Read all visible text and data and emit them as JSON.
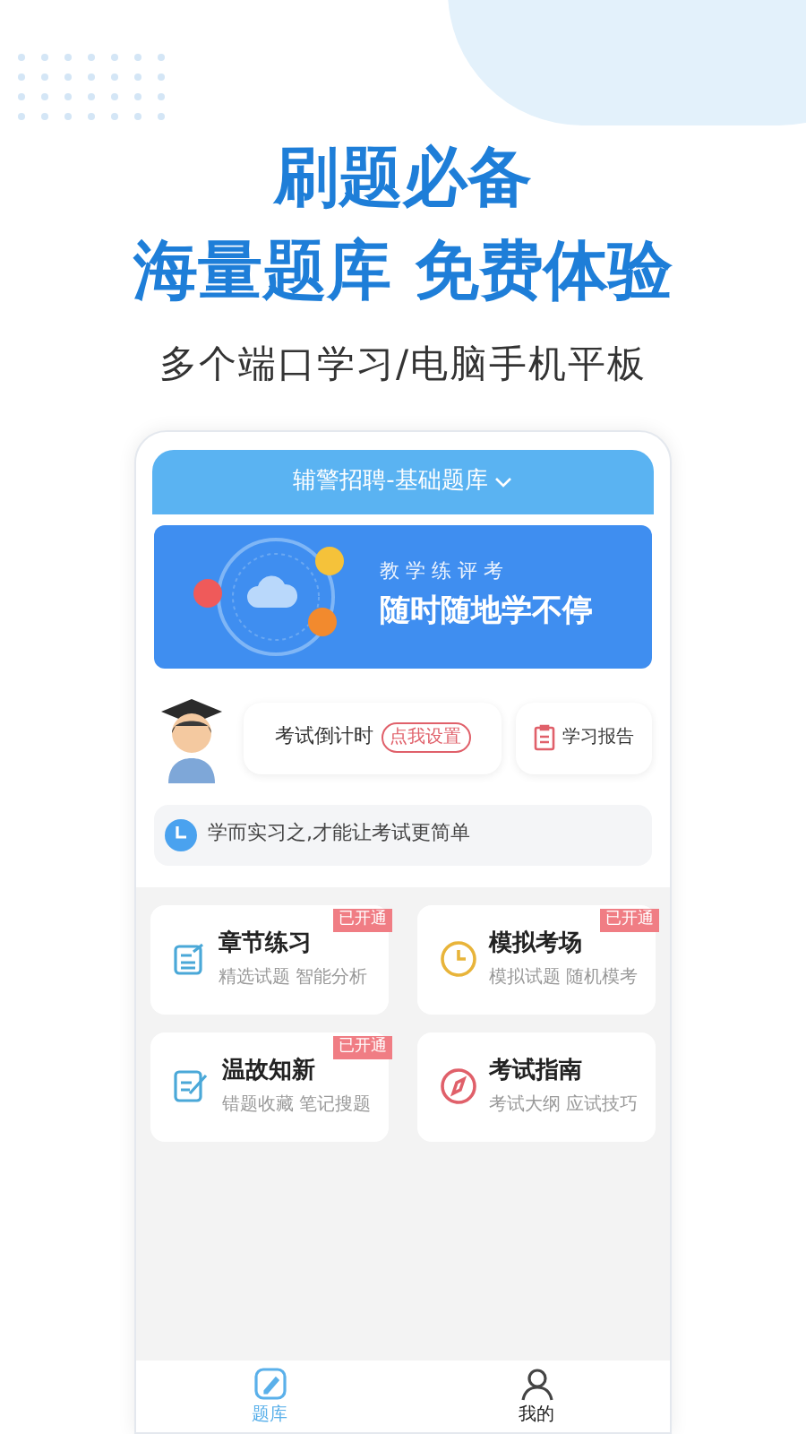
{
  "headline": [
    "刷题必备",
    "海量题库 免费体验"
  ],
  "subtitle": "多个端口学习/电脑手机平板",
  "app": {
    "header": {
      "title": "辅警招聘-基础题库"
    },
    "banner": {
      "tagline": "教 学 练 评 考",
      "slogan": "随时随地学不停"
    },
    "countdown": {
      "label": "考试倒计时",
      "action": "点我设置"
    },
    "report": {
      "label": "学习报告"
    },
    "tip": "学而实习之,才能让考试更简单",
    "cards": [
      {
        "kind": "practice",
        "title": "章节练习",
        "desc": "精选试题 智能分析",
        "badge": "已开通"
      },
      {
        "kind": "mock",
        "title": "模拟考场",
        "desc": "模拟试题 随机模考",
        "badge": "已开通"
      },
      {
        "kind": "review",
        "title": "温故知新",
        "desc": "错题收藏 笔记搜题",
        "badge": "已开通"
      },
      {
        "kind": "guide",
        "title": "考试指南",
        "desc": "考试大纲 应试技巧"
      }
    ],
    "tabs": [
      {
        "kind": "bank",
        "label": "题库",
        "selected": true
      },
      {
        "kind": "me",
        "label": "我的",
        "selected": false
      }
    ]
  }
}
